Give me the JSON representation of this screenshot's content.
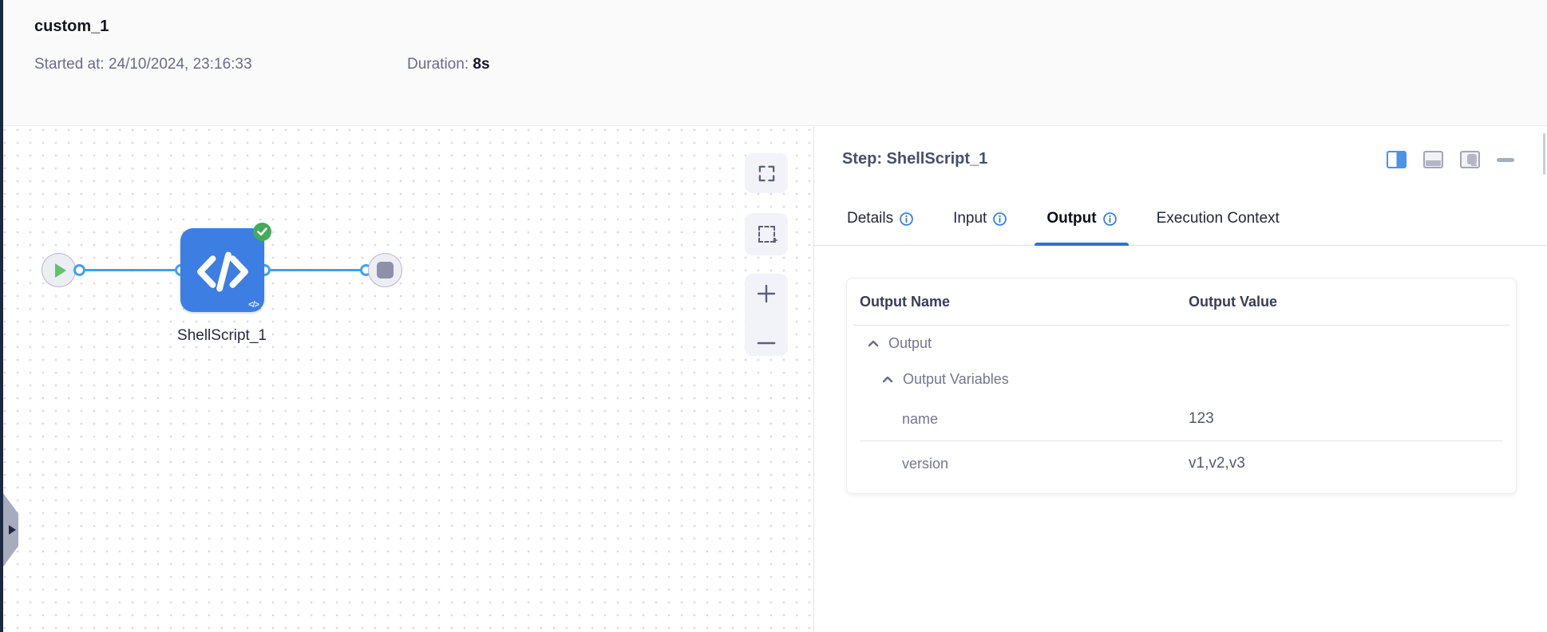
{
  "header": {
    "title": "custom_1",
    "started_label": "Started at:",
    "started_value": "24/10/2024, 23:16:33",
    "duration_label": "Duration:",
    "duration_value": "8s"
  },
  "canvas": {
    "node_label": "ShellScript_1",
    "node_status": "success",
    "mini_code_glyph": "</>",
    "controls": {
      "zoom_in_label": "+",
      "zoom_out_label": "−"
    }
  },
  "panel": {
    "title": "Step: ShellScript_1",
    "tabs": [
      {
        "label": "Details",
        "has_info": true,
        "active": false
      },
      {
        "label": "Input",
        "has_info": true,
        "active": false
      },
      {
        "label": "Output",
        "has_info": true,
        "active": true
      },
      {
        "label": "Execution Context",
        "has_info": false,
        "active": false
      }
    ],
    "table": {
      "columns": [
        "Output Name",
        "Output Value"
      ],
      "rows": [
        {
          "name": "Output",
          "value": "",
          "level": 0,
          "expandable": true,
          "expanded": true
        },
        {
          "name": "Output Variables",
          "value": "",
          "level": 1,
          "expandable": true,
          "expanded": true
        },
        {
          "name": "name",
          "value": "123",
          "level": 2,
          "expandable": false
        },
        {
          "name": "version",
          "value": "v1,v2,v3",
          "level": 2,
          "expandable": false,
          "divider_before": true
        }
      ]
    }
  },
  "colors": {
    "accent_blue": "#2f72d8",
    "info_blue": "#2c7be5",
    "node_blue": "#3c7ee1",
    "edge_blue": "#3ea2f3",
    "success_green": "#43ab5b",
    "sidebar_dark": "#1a2940"
  }
}
